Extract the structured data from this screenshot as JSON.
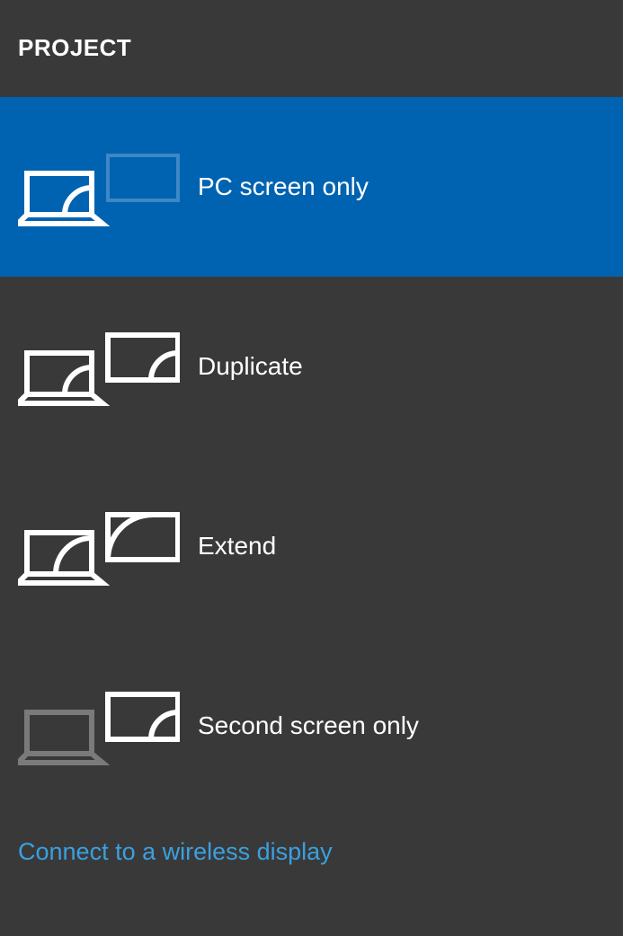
{
  "header": {
    "title": "PROJECT"
  },
  "options": [
    {
      "id": "pc-screen-only",
      "label": "PC screen only",
      "selected": true
    },
    {
      "id": "duplicate",
      "label": "Duplicate",
      "selected": false
    },
    {
      "id": "extend",
      "label": "Extend",
      "selected": false
    },
    {
      "id": "second-screen-only",
      "label": "Second screen only",
      "selected": false
    }
  ],
  "footer": {
    "wireless_link": "Connect to a wireless display"
  },
  "colors": {
    "background": "#393939",
    "accent": "#0063b1",
    "link": "#3aa0e0",
    "dim": "#7a7a7a"
  }
}
